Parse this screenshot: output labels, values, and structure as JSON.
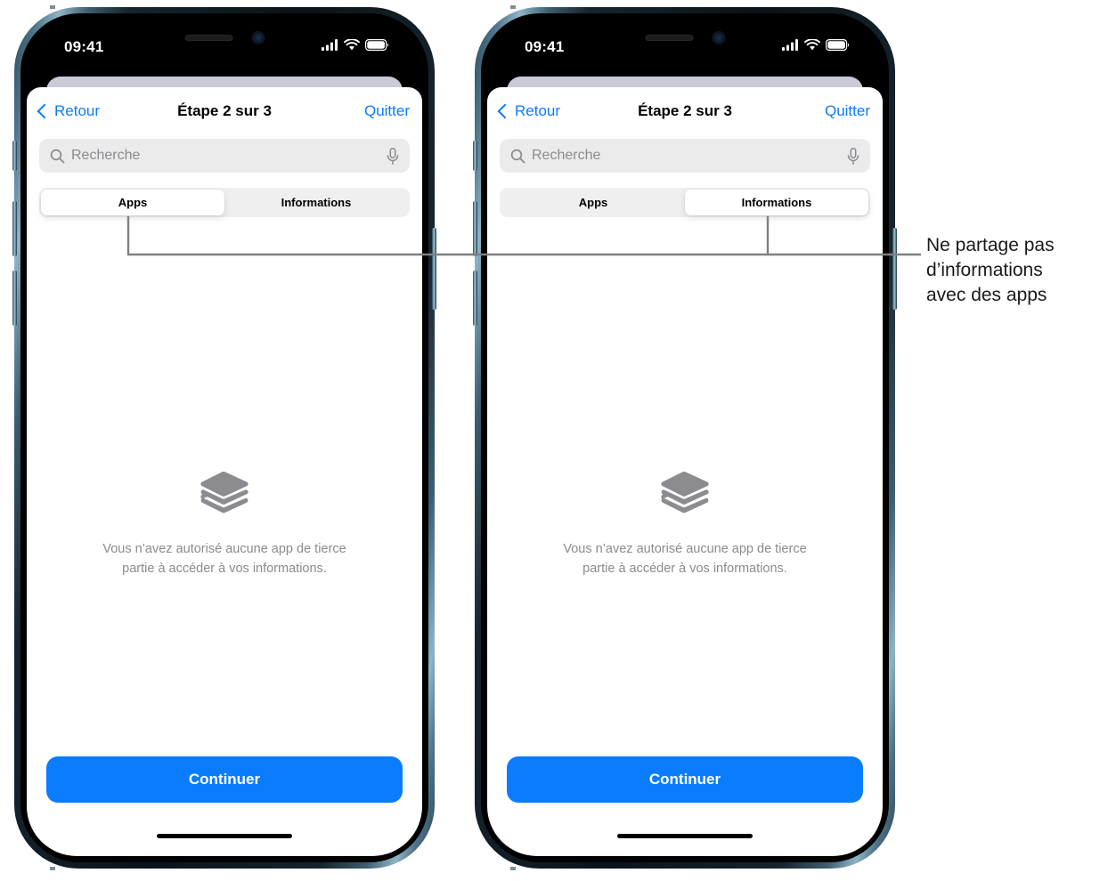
{
  "page": {
    "title": "Étape 2 sur 3 — Apps / Informations"
  },
  "status_bar": {
    "time": "09:41",
    "cellular_icon": "cellular-signal-icon",
    "wifi_icon": "wifi-icon",
    "battery_icon": "battery-icon"
  },
  "nav": {
    "back_label": "Retour",
    "title": "Étape 2 sur 3",
    "quit_label": "Quitter",
    "back_icon": "chevron-left-icon"
  },
  "search": {
    "placeholder": "Recherche",
    "value": "",
    "search_icon": "search-icon",
    "dictate_icon": "microphone-icon"
  },
  "segmented_control": {
    "options": [
      "Apps",
      "Informations"
    ],
    "left_phone_selected": "Apps",
    "right_phone_selected": "Informations"
  },
  "empty_state": {
    "icon": "layer-stack-icon",
    "line1": "Vous n’avez autorisé aucune app de tierce",
    "line2": "partie à accéder à vos informations."
  },
  "cta": {
    "continue_label": "Continuer"
  },
  "callout": {
    "line1": "Ne partage pas",
    "line2": "d’informations",
    "line3": "avec des apps"
  },
  "colors": {
    "accent_blue": "#0a7cff",
    "segment_track": "#efeff0",
    "search_field": "#ebebec",
    "muted_text": "#8b8b8f",
    "callout_line": "#808080",
    "sheet_behind": "#c9cbd6"
  }
}
